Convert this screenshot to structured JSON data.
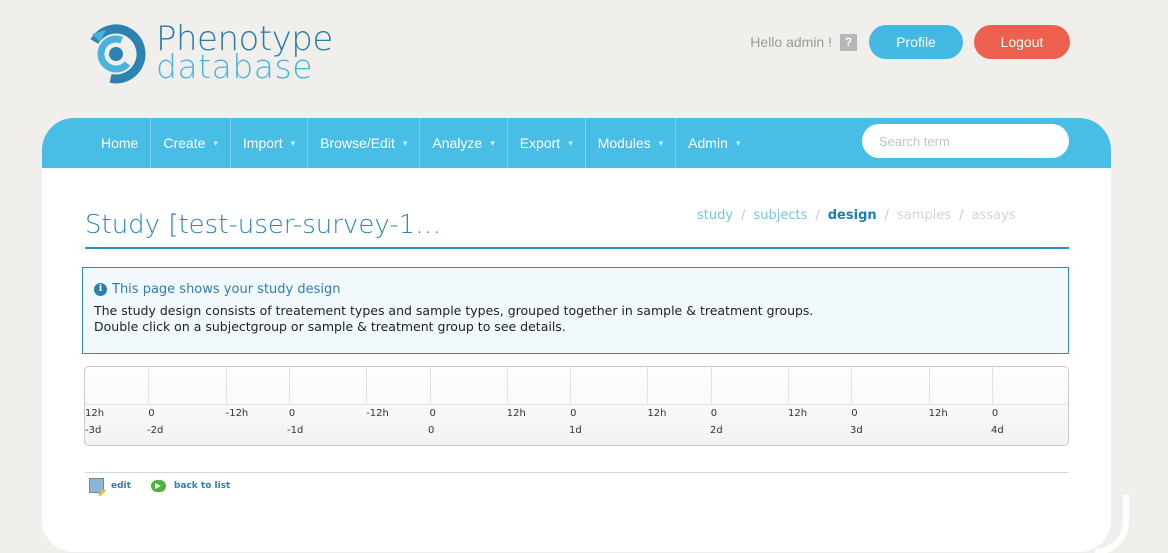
{
  "header": {
    "logo_line1": "Phenotype",
    "logo_line2": "database",
    "greeting": "Hello admin !",
    "help_label": "?",
    "profile_label": "Profile",
    "logout_label": "Logout"
  },
  "nav": {
    "items": [
      {
        "label": "Home",
        "dropdown": false
      },
      {
        "label": "Create",
        "dropdown": true
      },
      {
        "label": "Import",
        "dropdown": true
      },
      {
        "label": "Browse/Edit",
        "dropdown": true
      },
      {
        "label": "Analyze",
        "dropdown": true
      },
      {
        "label": "Export",
        "dropdown": true
      },
      {
        "label": "Modules",
        "dropdown": true
      },
      {
        "label": "Admin",
        "dropdown": true
      }
    ],
    "search_placeholder": "Search term"
  },
  "page": {
    "title": "Study [test-user-survey-1…",
    "breadcrumb": {
      "study": "study",
      "subjects": "subjects",
      "design": "design",
      "samples": "samples",
      "assays": "assays"
    }
  },
  "info": {
    "icon_glyph": "i",
    "heading": "This page shows your study design",
    "line1": "The study design consists of treatement types and sample types, grouped together in sample & treatment groups.",
    "line2": "Double click on a subjectgroup or sample & treatment group to see details."
  },
  "timeline": {
    "hours": [
      "12h",
      "0",
      "-12h",
      "0",
      "-12h",
      "0",
      "12h",
      "0",
      "12h",
      "0",
      "12h",
      "0",
      "12h",
      "0"
    ],
    "days": [
      "-3d",
      "-2d",
      "-1d",
      "0",
      "1d",
      "2d",
      "3d",
      "4d"
    ]
  },
  "footer": {
    "edit_label": "edit",
    "back_label": "back to list"
  },
  "colors": {
    "nav": "#48bde6",
    "profile": "#42b8e2",
    "logout": "#ec604d",
    "title": "#2a86b8"
  }
}
